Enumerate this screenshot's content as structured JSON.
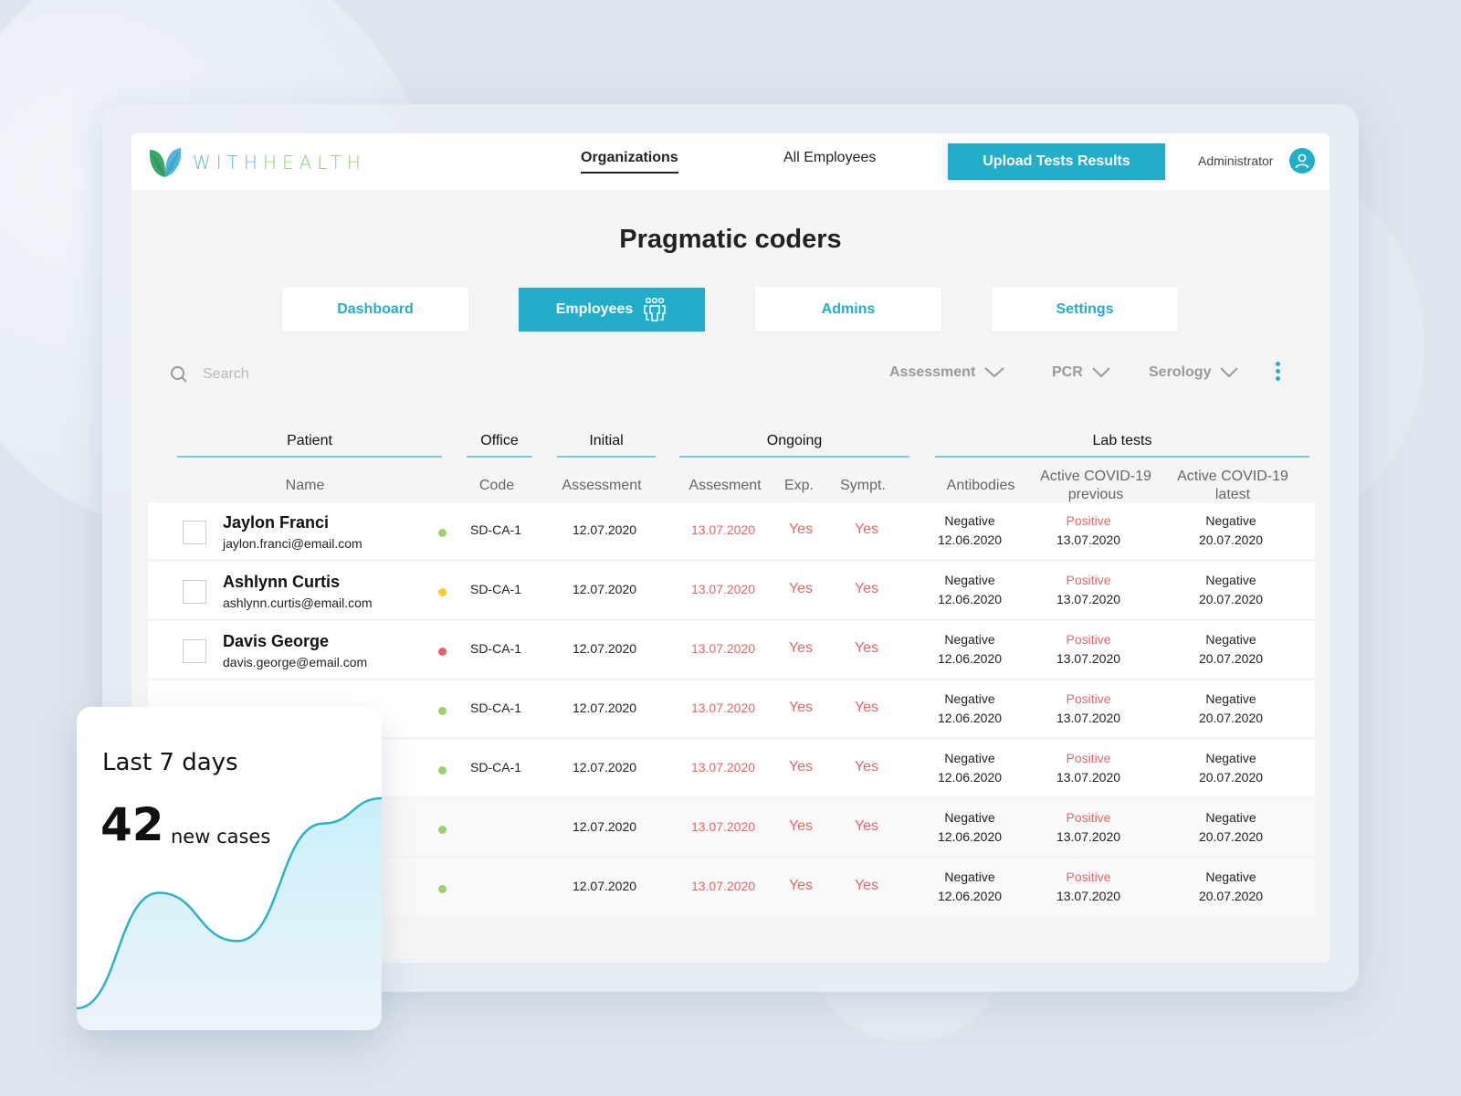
{
  "brand": {
    "part1": "WITH",
    "part2": "HEALTH",
    "accent": "#22adc9"
  },
  "nav": {
    "items": [
      {
        "label": "Organizations",
        "active": true
      },
      {
        "label": "All Employees",
        "active": false
      }
    ],
    "upload_button": "Upload Tests Results",
    "user_role": "Administrator"
  },
  "page": {
    "title": "Pragmatic coders",
    "tabs": [
      {
        "label": "Dashboard",
        "active": false
      },
      {
        "label": "Employees",
        "active": true,
        "icon": "people-icon"
      },
      {
        "label": "Admins",
        "active": false
      },
      {
        "label": "Settings",
        "active": false
      }
    ]
  },
  "toolbar": {
    "search_placeholder": "Search",
    "filters": [
      "Assessment",
      "PCR",
      "Serology"
    ]
  },
  "table": {
    "groups": [
      "Patient",
      "Office",
      "Initial",
      "Ongoing",
      "Lab tests"
    ],
    "columns": [
      "Name",
      "Code",
      "Assessment",
      "Assesment",
      "Exp.",
      "Sympt.",
      "Antibodies",
      "Active COVID-19 previous",
      "Active COVID-19 latest"
    ],
    "columns_split": {
      "prev_line1": "Active COVID-19",
      "prev_line2": "previous",
      "latest_line1": "Active COVID-19",
      "latest_line2": "latest"
    },
    "status_colors": {
      "green": "#9bd06c",
      "yellow": "#f7cc2e",
      "red": "#e86060"
    },
    "rows": [
      {
        "name": "Jaylon Franci",
        "email": "jaylon.franci@email.com",
        "status": "green",
        "code": "SD-CA-1",
        "initial": "12.07.2020",
        "ongoing": "13.07.2020",
        "exp": "Yes",
        "sympt": "Yes",
        "antibodies": "Negative",
        "antibodies_date": "12.06.2020",
        "prev": "Positive",
        "prev_date": "13.07.2020",
        "latest": "Negative",
        "latest_date": "20.07.2020"
      },
      {
        "name": "Ashlynn Curtis",
        "email": "ashlynn.curtis@email.com",
        "status": "yellow",
        "code": "SD-CA-1",
        "initial": "12.07.2020",
        "ongoing": "13.07.2020",
        "exp": "Yes",
        "sympt": "Yes",
        "antibodies": "Negative",
        "antibodies_date": "12.06.2020",
        "prev": "Positive",
        "prev_date": "13.07.2020",
        "latest": "Negative",
        "latest_date": "20.07.2020"
      },
      {
        "name": "Davis George",
        "email": "davis.george@email.com",
        "status": "red",
        "code": "SD-CA-1",
        "initial": "12.07.2020",
        "ongoing": "13.07.2020",
        "exp": "Yes",
        "sympt": "Yes",
        "antibodies": "Negative",
        "antibodies_date": "12.06.2020",
        "prev": "Positive",
        "prev_date": "13.07.2020",
        "latest": "Negative",
        "latest_date": "20.07.2020"
      },
      {
        "name": "",
        "email": "",
        "status": "green",
        "code": "SD-CA-1",
        "initial": "12.07.2020",
        "ongoing": "13.07.2020",
        "exp": "Yes",
        "sympt": "Yes",
        "antibodies": "Negative",
        "antibodies_date": "12.06.2020",
        "prev": "Positive",
        "prev_date": "13.07.2020",
        "latest": "Negative",
        "latest_date": "20.07.2020"
      },
      {
        "name": "",
        "email": "",
        "status": "green",
        "code": "SD-CA-1",
        "initial": "12.07.2020",
        "ongoing": "13.07.2020",
        "exp": "Yes",
        "sympt": "Yes",
        "antibodies": "Negative",
        "antibodies_date": "12.06.2020",
        "prev": "Positive",
        "prev_date": "13.07.2020",
        "latest": "Negative",
        "latest_date": "20.07.2020"
      },
      {
        "name": "",
        "email": "",
        "status": "green",
        "code": "",
        "initial": "12.07.2020",
        "ongoing": "13.07.2020",
        "exp": "Yes",
        "sympt": "Yes",
        "antibodies": "Negative",
        "antibodies_date": "12.06.2020",
        "prev": "Positive",
        "prev_date": "13.07.2020",
        "latest": "Negative",
        "latest_date": "20.07.2020"
      },
      {
        "name": "",
        "email": "",
        "status": "green",
        "code": "",
        "initial": "12.07.2020",
        "ongoing": "13.07.2020",
        "exp": "Yes",
        "sympt": "Yes",
        "antibodies": "Negative",
        "antibodies_date": "12.06.2020",
        "prev": "Positive",
        "prev_date": "13.07.2020",
        "latest": "Negative",
        "latest_date": "20.07.2020"
      }
    ]
  },
  "card": {
    "title": "Last 7 days",
    "value": "42",
    "label": "new cases",
    "trend_relative": [
      0.0,
      0.55,
      0.32,
      0.88,
      1.0
    ]
  }
}
